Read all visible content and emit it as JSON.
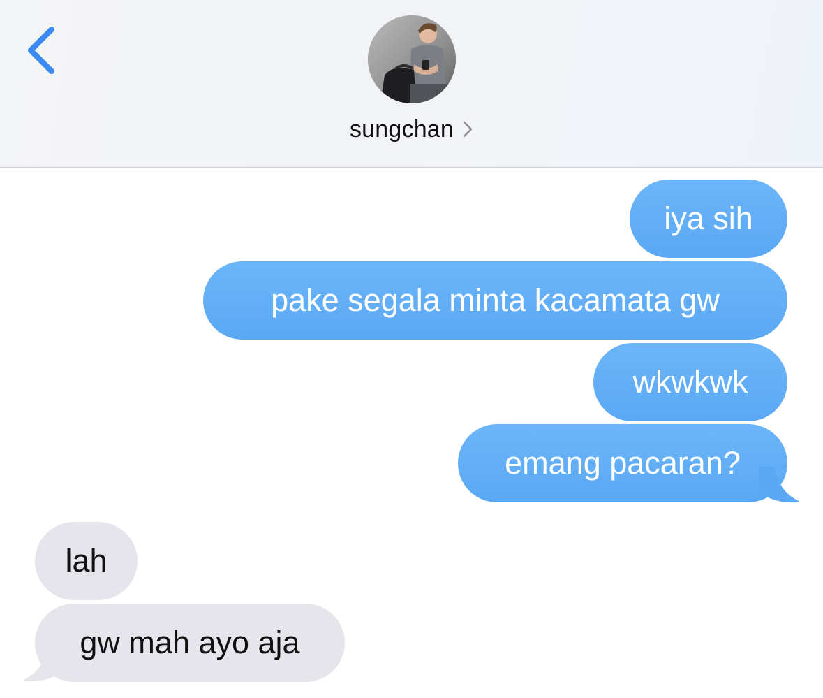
{
  "header": {
    "contact_name": "sungchan",
    "back_icon": "chevron-left-icon",
    "detail_icon": "chevron-right-icon"
  },
  "colors": {
    "accent": "#3c8bf0",
    "sent_bubble": "#63aff6",
    "received_bubble": "#e6e5eb",
    "sent_text": "#ffffff",
    "received_text": "#111111"
  },
  "messages": [
    {
      "direction": "sent",
      "text": "iya sih"
    },
    {
      "direction": "sent",
      "text": "pake segala minta kacamata gw"
    },
    {
      "direction": "sent",
      "text": "wkwkwk"
    },
    {
      "direction": "sent",
      "text": "emang pacaran?"
    },
    {
      "direction": "received",
      "text": "lah"
    },
    {
      "direction": "received",
      "text": "gw mah ayo aja"
    }
  ]
}
